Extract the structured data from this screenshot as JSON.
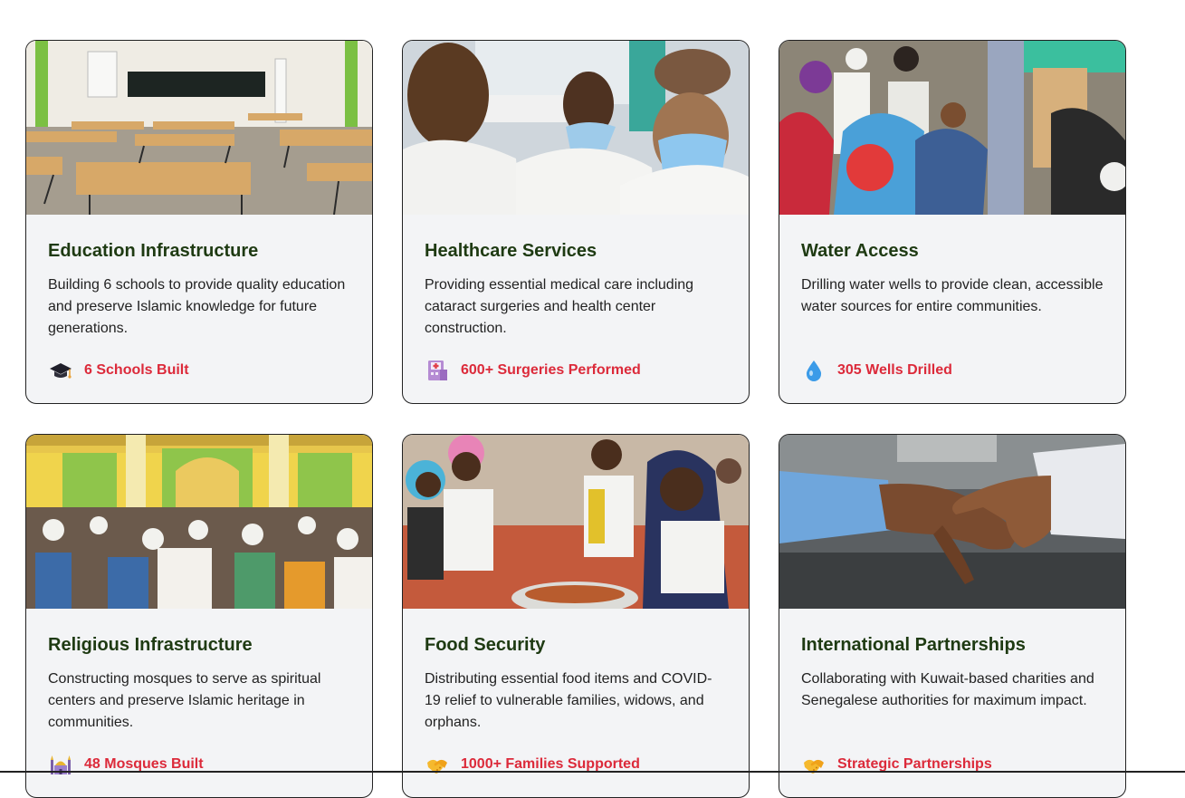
{
  "cards": [
    {
      "title": "Education Infrastructure",
      "description": "Building 6 schools to provide quality education and preserve Islamic knowledge for future generations.",
      "stat": "6 Schools Built",
      "icon": "graduation-cap-icon",
      "image": "empty-classroom-photo"
    },
    {
      "title": "Healthcare Services",
      "description": "Providing essential medical care including cataract surgeries and health center construction.",
      "stat": "600+ Surgeries Performed",
      "icon": "hospital-icon",
      "image": "medical-staff-photo"
    },
    {
      "title": "Water Access",
      "description": "Drilling water wells to provide clean, accessible water sources for entire communities.",
      "stat": "305 Wells Drilled",
      "icon": "water-drop-icon",
      "image": "water-well-crowd-photo"
    },
    {
      "title": "Religious Infrastructure",
      "description": "Constructing mosques to serve as spiritual centers and preserve Islamic heritage in communities.",
      "stat": "48 Mosques Built",
      "icon": "mosque-icon",
      "image": "mosque-prayer-photo"
    },
    {
      "title": "Food Security",
      "description": "Distributing essential food items and COVID-19 relief to vulnerable families, widows, and orphans.",
      "stat": "1000+ Families Supported",
      "icon": "handshake-icon",
      "image": "children-eating-photo"
    },
    {
      "title": "International Partnerships",
      "description": "Collaborating with Kuwait-based charities and Senegalese authorities for maximum impact.",
      "stat": "Strategic Partnerships",
      "icon": "handshake-icon",
      "image": "handshake-photo"
    }
  ],
  "colors": {
    "title": "#1e3a12",
    "stat": "#dc2a3a",
    "card_bg": "#f3f4f6"
  }
}
